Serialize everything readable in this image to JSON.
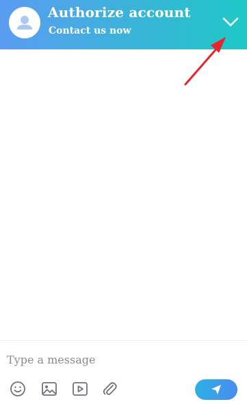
{
  "header": {
    "title": "Authorize account",
    "subtitle": "Contact us now",
    "avatar_icon": "user-avatar-icon",
    "collapse_icon": "chevron-down-icon"
  },
  "composer": {
    "placeholder": "Type a message",
    "tools": [
      "emoji-icon",
      "image-icon",
      "video-icon",
      "attachment-icon"
    ],
    "send_icon": "send-icon"
  },
  "colors": {
    "header_gradient_start": "#5b9cf1",
    "header_gradient_end": "#1ec8c6",
    "send_gradient_start": "#2cb1e4",
    "send_gradient_end": "#4a8cf0",
    "annotation_arrow": "#e8232a"
  }
}
